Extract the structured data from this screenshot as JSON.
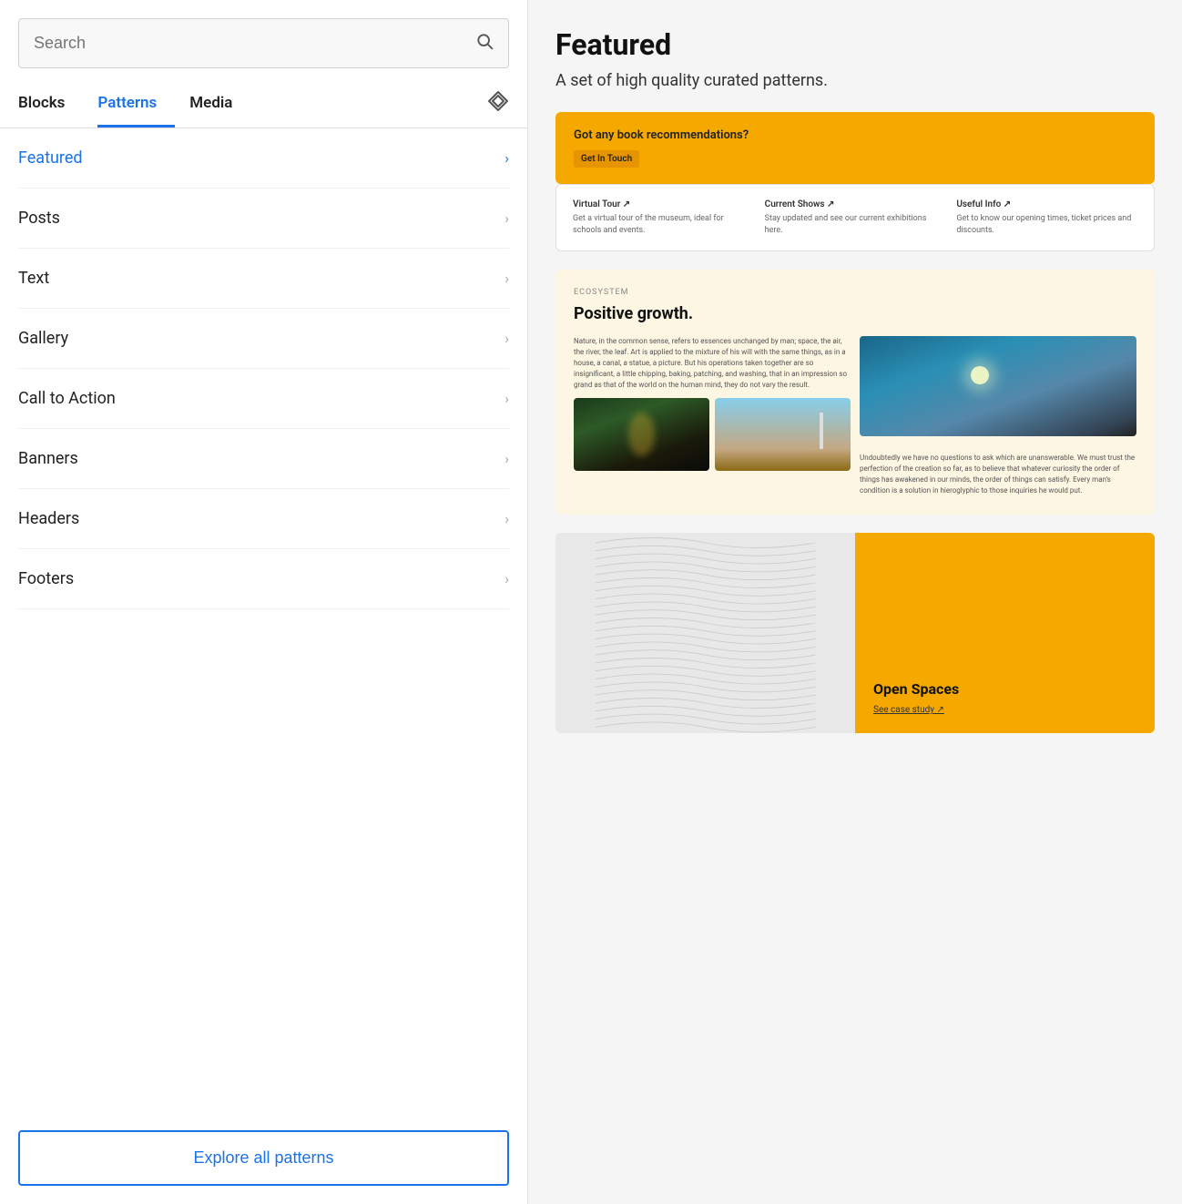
{
  "left": {
    "search": {
      "placeholder": "Search",
      "icon": "🔍"
    },
    "tabs": [
      {
        "id": "blocks",
        "label": "Blocks",
        "active": false
      },
      {
        "id": "patterns",
        "label": "Patterns",
        "active": true
      },
      {
        "id": "media",
        "label": "Media",
        "active": false
      }
    ],
    "nav_items": [
      {
        "id": "featured",
        "label": "Featured",
        "active": true
      },
      {
        "id": "posts",
        "label": "Posts",
        "active": false
      },
      {
        "id": "text",
        "label": "Text",
        "active": false
      },
      {
        "id": "gallery",
        "label": "Gallery",
        "active": false
      },
      {
        "id": "call-to-action",
        "label": "Call to Action",
        "active": false
      },
      {
        "id": "banners",
        "label": "Banners",
        "active": false
      },
      {
        "id": "headers",
        "label": "Headers",
        "active": false
      },
      {
        "id": "footers",
        "label": "Footers",
        "active": false
      }
    ],
    "explore_btn": "Explore all patterns"
  },
  "right": {
    "title": "Featured",
    "subtitle": "A set of high quality curated patterns.",
    "patterns": {
      "cta_yellow": {
        "title": "Got any book recommendations?",
        "button": "Get In Touch"
      },
      "links": {
        "items": [
          {
            "title": "Virtual Tour ↗",
            "desc": "Get a virtual tour of the museum, ideal for schools and events."
          },
          {
            "title": "Current Shows ↗",
            "desc": "Stay updated and see our current exhibitions here."
          },
          {
            "title": "Useful Info ↗",
            "desc": "Get to know our opening times, ticket prices and discounts."
          }
        ]
      },
      "ecosystem": {
        "label": "ECOSYSTEM",
        "title": "Positive growth.",
        "text": "Nature, in the common sense, refers to essences unchanged by man; space, the air, the river, the leaf. Art is applied to the mixture of his will with the same things, as in a house, a canal, a statue, a picture. But his operations taken together are so insignificant, a little chipping, baking, patching, and washing, that in an impression so grand as that of the world on the human mind, they do not vary the result.",
        "right_text": "Undoubtedly we have no questions to ask which are unanswerable. We must trust the perfection of the creation so far, as to believe that whatever curiosity the order of things has awakened in our minds, the order of things can satisfy. Every man's condition is a solution in hieroglyphic to those inquiries he would put."
      },
      "open_spaces": {
        "title": "Open Spaces",
        "link": "See case study ↗"
      }
    }
  }
}
